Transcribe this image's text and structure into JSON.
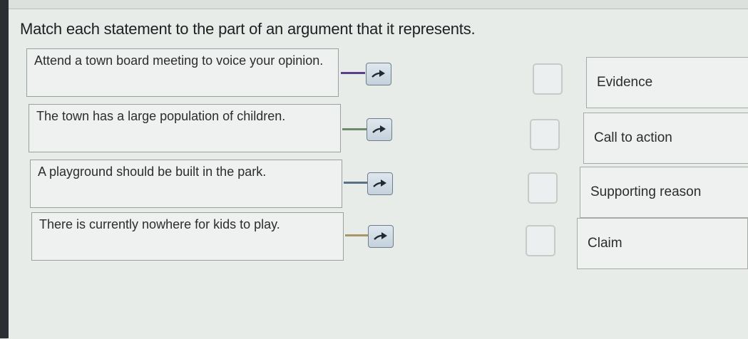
{
  "prompt": "Match each statement to the part of an argument that it represents.",
  "statements": [
    {
      "text": "Attend a town board meeting to voice your opinion.",
      "connector_color": "#5a3f8c"
    },
    {
      "text": "The town has a large population of children.",
      "connector_color": "#6f8a6a"
    },
    {
      "text": "A playground should be built in the park.",
      "connector_color": "#5b6f88"
    },
    {
      "text": "There is currently nowhere for kids to play.",
      "connector_color": "#a9956a"
    }
  ],
  "answers": [
    {
      "text": "Evidence"
    },
    {
      "text": "Call to action"
    },
    {
      "text": "Supporting reason"
    },
    {
      "text": "Claim"
    }
  ],
  "icons": {
    "arrow": "arrow-right-icon"
  }
}
